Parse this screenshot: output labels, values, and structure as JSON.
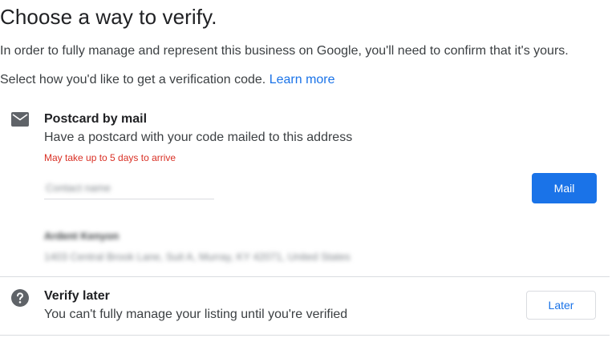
{
  "page": {
    "title": "Choose a way to verify.",
    "intro": "In order to fully manage and represent this business on Google, you'll need to confirm that it's yours.",
    "select_text": "Select how you'd like to get a verification code.",
    "learn_more": "Learn more"
  },
  "options": [
    {
      "icon": "mail-icon",
      "title": "Postcard by mail",
      "description": "Have a postcard with your code mailed to this address",
      "warning": "May take up to 5 days to arrive",
      "contact_placeholder": "Contact name",
      "address_name": "Ardent Kenyon",
      "address_line": "1403 Central Brook Lane, Suit A, Murray, KY 42071, United States",
      "button_label": "Mail"
    },
    {
      "icon": "help-icon",
      "title": "Verify later",
      "description": "You can't fully manage your listing until you're verified",
      "button_label": "Later"
    }
  ],
  "colors": {
    "accent": "#1a73e8",
    "warning": "#d93025",
    "divider": "#dadce0",
    "icon": "#5f6368"
  }
}
